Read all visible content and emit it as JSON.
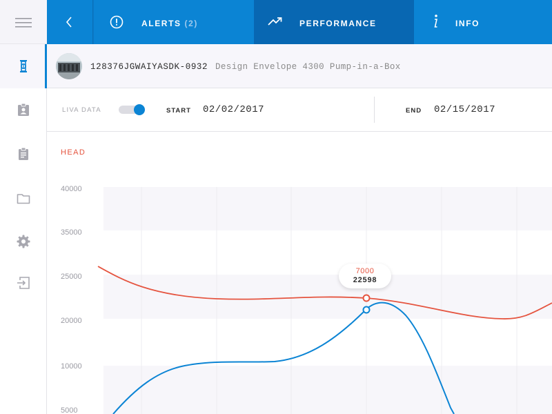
{
  "sidebar": {
    "items": [
      {
        "icon": "hamburger-menu-icon"
      },
      {
        "icon": "pump-icon",
        "active": true
      },
      {
        "icon": "id-badge-icon"
      },
      {
        "icon": "clipboard-icon"
      },
      {
        "icon": "folder-icon"
      },
      {
        "icon": "gear-icon"
      },
      {
        "icon": "logout-icon"
      }
    ]
  },
  "nav": {
    "back_icon": "chevron-left-icon",
    "tabs": [
      {
        "label": "ALERTS",
        "count": "(2)",
        "icon": "alert-circle-icon"
      },
      {
        "label": "PERFORMANCE",
        "icon": "trend-up-icon",
        "active": true
      },
      {
        "label": "INFO",
        "icon": "info-icon"
      }
    ]
  },
  "device": {
    "id": "128376JGWAIYASDK-0932",
    "name": "Design Envelope 4300 Pump-in-a-Box"
  },
  "filters": {
    "live_label": "LIVA DATA",
    "live_enabled": true,
    "start_label": "START",
    "start_date": "02/02/2017",
    "end_label": "END",
    "end_date": "02/15/2017"
  },
  "chart": {
    "title": "HEAD",
    "y_ticks": [
      "40000",
      "35000",
      "25000",
      "20000",
      "10000",
      "5000"
    ],
    "tooltip": {
      "head": "7000",
      "flow": "22598"
    },
    "colors": {
      "head": "#e5543f",
      "flow": "#0b84d4"
    }
  }
}
